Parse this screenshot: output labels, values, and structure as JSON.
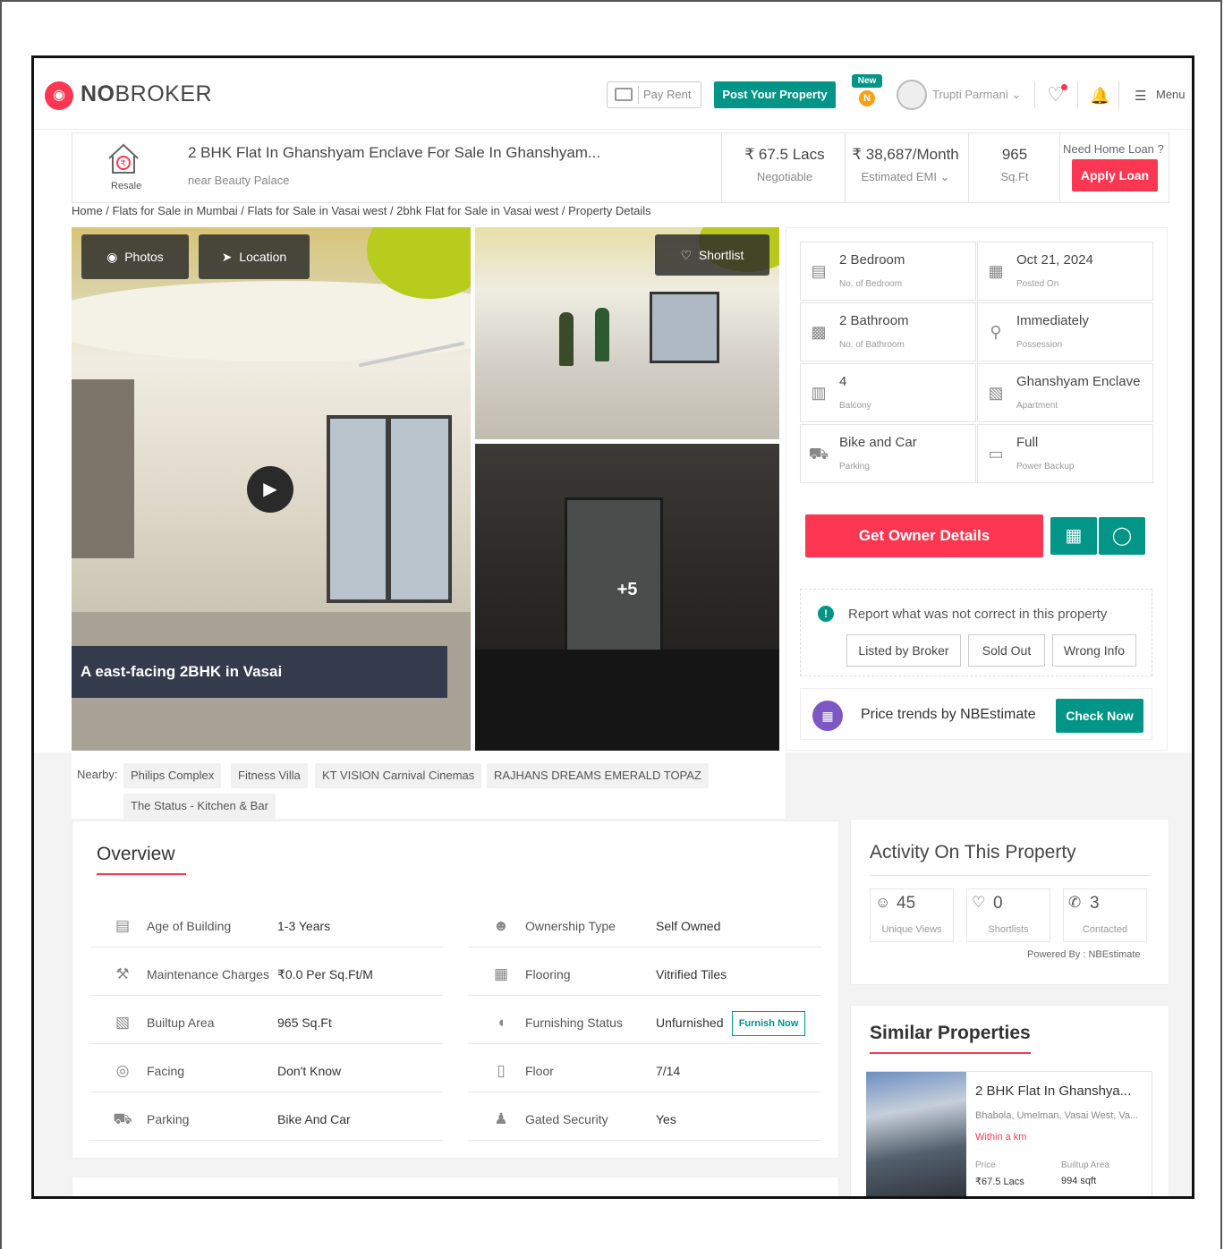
{
  "header": {
    "logo_icon": "nobroker-logo-icon",
    "logo_bold": "NO",
    "logo_light": "BROKER",
    "pay_rent": "Pay Rent",
    "post_property": "Post Your Property",
    "new_badge": "New",
    "n_badge": "N",
    "user_name": "Trupti Parmani",
    "menu": "Menu",
    "accent": "#fd3752",
    "teal": "#009587"
  },
  "property": {
    "title": "2 BHK Flat In Ghanshyam Enclave For Sale In Ghanshyam...",
    "landmark": "near Beauty Palace",
    "type_badge": "Resale",
    "price": "₹ 67.5 Lacs",
    "price_note": "Negotiable",
    "emi": "₹ 38,687/Month",
    "emi_label": "Estimated EMI",
    "area": "965",
    "area_unit": "Sq.Ft",
    "loan_question": "Need Home Loan ?",
    "apply_loan": "Apply Loan"
  },
  "breadcrumb": "Home / Flats for Sale in Mumbai / Flats for Sale in Vasai west / 2bhk Flat for Sale in Vasai west / Property Details",
  "gallery": {
    "photos_btn": "Photos",
    "location_btn": "Location",
    "shortlist_btn": "Shortlist",
    "caption": "A east-facing 2BHK in Vasai",
    "more_count": "+5"
  },
  "specs": [
    {
      "value": "2 Bedroom",
      "label": "No. of Bedroom",
      "icon": "bed-icon"
    },
    {
      "value": "Oct 21, 2024",
      "label": "Posted On",
      "icon": "calendar-icon"
    },
    {
      "value": "2 Bathroom",
      "label": "No. of Bathroom",
      "icon": "bathtub-icon"
    },
    {
      "value": "Immediately",
      "label": "Possession",
      "icon": "key-icon"
    },
    {
      "value": "4",
      "label": "Balcony",
      "icon": "balcony-icon"
    },
    {
      "value": "Ghanshyam Enclave",
      "label": "Apartment",
      "icon": "building-icon"
    },
    {
      "value": "Bike and Car",
      "label": "Parking",
      "icon": "car-icon"
    },
    {
      "value": "Full",
      "label": "Power Backup",
      "icon": "battery-icon"
    }
  ],
  "actions": {
    "owner_details": "Get Owner Details",
    "report_text": "Report what was not correct in this property",
    "report_options": [
      "Listed by Broker",
      "Sold Out",
      "Wrong Info"
    ],
    "price_trends": "Price trends by NBEstimate",
    "check_now": "Check Now"
  },
  "nearby": {
    "label": "Nearby:",
    "places": [
      "Philips Complex",
      "Fitness Villa",
      "KT VISION Carnival Cinemas",
      "RAJHANS DREAMS EMERALD TOPAZ",
      "The Status - Kitchen & Bar"
    ]
  },
  "overview": {
    "title": "Overview",
    "left": [
      {
        "label": "Age of Building",
        "value": "1-3 Years",
        "icon": "building-age-icon"
      },
      {
        "label": "Maintenance Charges",
        "value": "₹0.0 Per Sq.Ft/M",
        "icon": "tools-icon"
      },
      {
        "label": "Builtup Area",
        "value": "965 Sq.Ft",
        "icon": "area-icon"
      },
      {
        "label": "Facing",
        "value": "Don't Know",
        "icon": "compass-icon"
      },
      {
        "label": "Parking",
        "value": "Bike And Car",
        "icon": "car-icon"
      }
    ],
    "right": [
      {
        "label": "Ownership Type",
        "value": "Self Owned",
        "icon": "owner-icon"
      },
      {
        "label": "Flooring",
        "value": "Vitrified Tiles",
        "icon": "tiles-icon"
      },
      {
        "label": "Furnishing Status",
        "value": "Unfurnished",
        "icon": "sofa-icon"
      },
      {
        "label": "Floor",
        "value": "7/14",
        "icon": "floor-icon"
      },
      {
        "label": "Gated Security",
        "value": "Yes",
        "icon": "guard-icon"
      }
    ],
    "furnish_now": "Furnish Now"
  },
  "activity": {
    "title": "Activity On This Property",
    "stats": [
      {
        "value": "45",
        "label": "Unique Views",
        "icon": "user-icon"
      },
      {
        "value": "0",
        "label": "Shortlists",
        "icon": "heart-icon"
      },
      {
        "value": "3",
        "label": "Contacted",
        "icon": "phone-icon"
      }
    ],
    "powered": "Powered By : NBEstimate"
  },
  "similar": {
    "title": "Similar Properties",
    "name": "2 BHK Flat In Ghanshya...",
    "location": "Bhabola, Umelman, Vasai West, Va...",
    "distance": "Within a km",
    "price_label": "Price",
    "price": "₹67.5 Lacs",
    "area_label": "Builtup Area",
    "area": "994 sqft"
  }
}
